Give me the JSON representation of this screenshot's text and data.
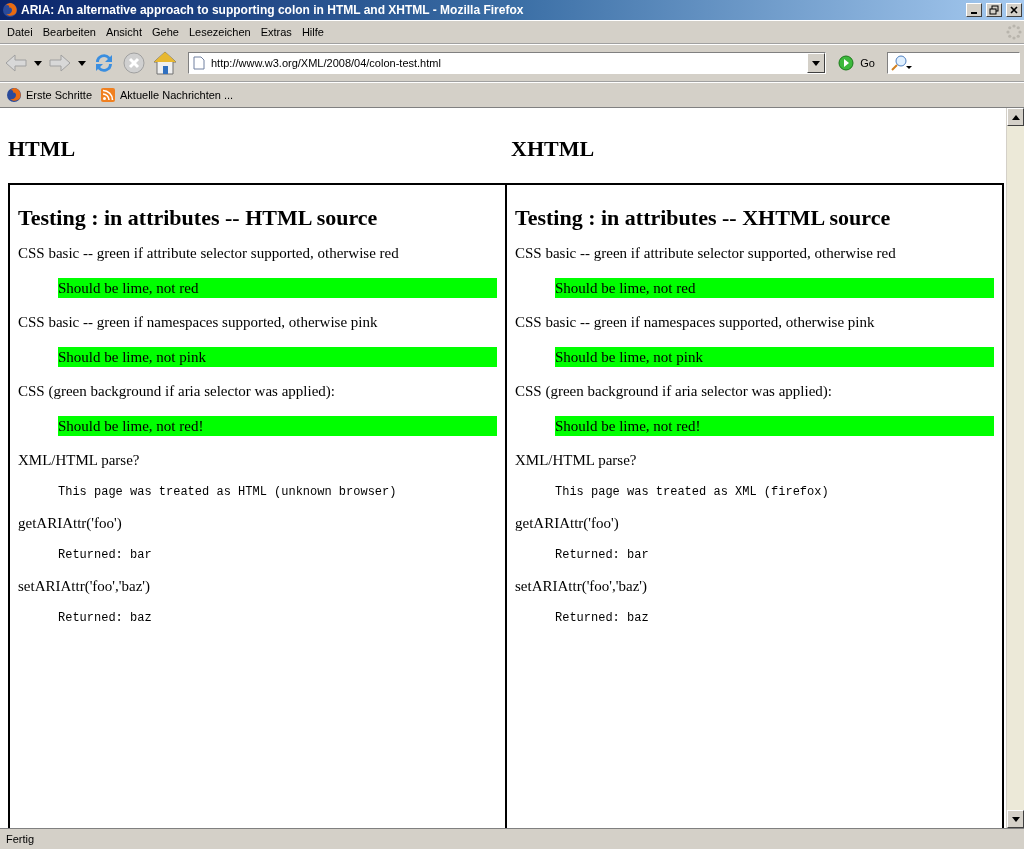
{
  "window": {
    "title": "ARIA: An alternative approach to supporting colon in HTML and XHTML - Mozilla Firefox"
  },
  "menu": [
    "Datei",
    "Bearbeiten",
    "Ansicht",
    "Gehe",
    "Lesezeichen",
    "Extras",
    "Hilfe"
  ],
  "address_bar": {
    "value": "http://www.w3.org/XML/2008/04/colon-test.html"
  },
  "go_button": "Go",
  "bookmarks": [
    "Erste Schritte",
    "Aktuelle Nachrichten ..."
  ],
  "page": {
    "column_headings": [
      "HTML",
      "XHTML"
    ],
    "frames": [
      {
        "heading": "Testing : in attributes -- HTML source",
        "items": [
          {
            "kind": "text",
            "text": "CSS basic -- green if attribute selector supported, otherwise red"
          },
          {
            "kind": "lime",
            "text": "Should be lime, not red"
          },
          {
            "kind": "text",
            "text": "CSS basic -- green if namespaces supported, otherwise pink"
          },
          {
            "kind": "lime",
            "text": "Should be lime, not pink"
          },
          {
            "kind": "text",
            "text": "CSS (green background if aria selector was applied):"
          },
          {
            "kind": "lime",
            "text": "Should be lime, not red!"
          },
          {
            "kind": "text",
            "text": "XML/HTML parse?"
          },
          {
            "kind": "code",
            "text": "This page was treated as HTML (unknown browser)"
          },
          {
            "kind": "text",
            "text": "getARIAttr('foo')"
          },
          {
            "kind": "code",
            "text": "Returned: bar"
          },
          {
            "kind": "text",
            "text": "setARIAttr('foo','baz')"
          },
          {
            "kind": "code",
            "text": "Returned: baz"
          }
        ]
      },
      {
        "heading": "Testing : in attributes -- XHTML source",
        "items": [
          {
            "kind": "text",
            "text": "CSS basic -- green if attribute selector supported, otherwise red"
          },
          {
            "kind": "lime",
            "text": "Should be lime, not red"
          },
          {
            "kind": "text",
            "text": "CSS basic -- green if namespaces supported, otherwise pink"
          },
          {
            "kind": "lime",
            "text": "Should be lime, not pink"
          },
          {
            "kind": "text",
            "text": "CSS (green background if aria selector was applied):"
          },
          {
            "kind": "lime",
            "text": "Should be lime, not red!"
          },
          {
            "kind": "text",
            "text": "XML/HTML parse?"
          },
          {
            "kind": "code",
            "text": "This page was treated as XML (firefox)"
          },
          {
            "kind": "text",
            "text": "getARIAttr('foo')"
          },
          {
            "kind": "code",
            "text": "Returned: bar"
          },
          {
            "kind": "text",
            "text": "setARIAttr('foo','baz')"
          },
          {
            "kind": "code",
            "text": "Returned: baz"
          }
        ]
      }
    ]
  },
  "status_bar": "Fertig"
}
